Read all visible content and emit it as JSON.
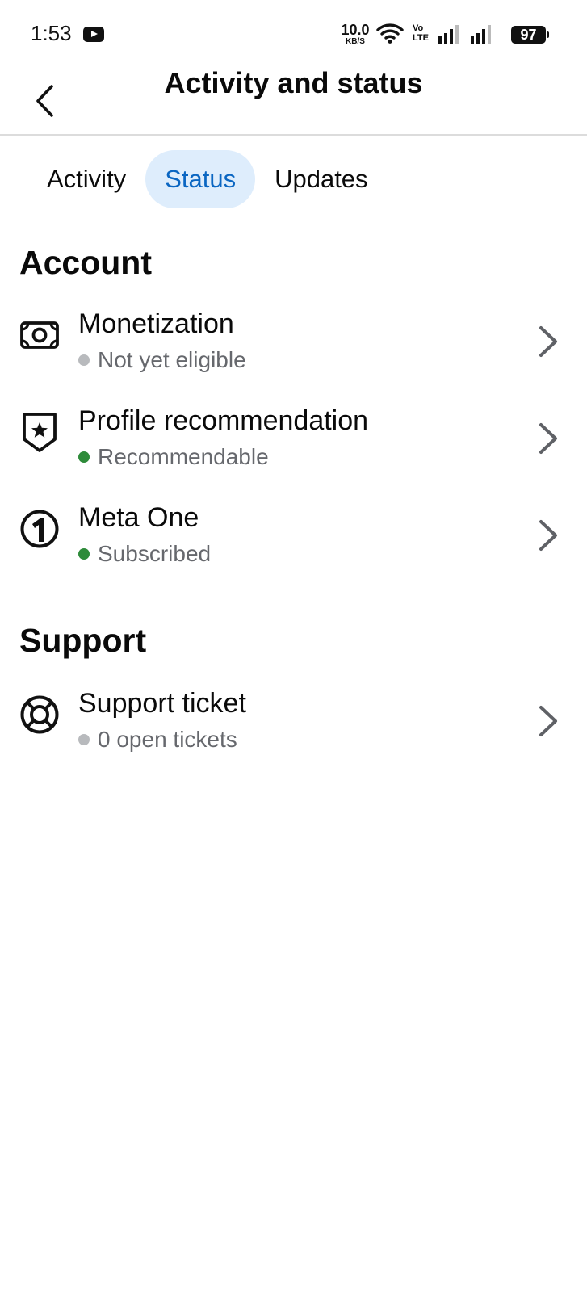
{
  "status_bar": {
    "time": "1:53",
    "notification_icon": "youtube-icon",
    "net_speed_value": "10.0",
    "net_speed_unit": "KB/S",
    "volte_top": "Vo",
    "volte_bottom": "LTE",
    "battery": "97"
  },
  "header": {
    "title": "Activity and status",
    "back_icon": "back-arrow-icon"
  },
  "tabs": [
    {
      "label": "Activity",
      "active": false
    },
    {
      "label": "Status",
      "active": true
    },
    {
      "label": "Updates",
      "active": false
    }
  ],
  "colors": {
    "accent_blue": "#0a66c2",
    "active_tab_bg": "#deedfc",
    "status_green": "#2e8b3a",
    "status_gray": "#b8babd",
    "subtitle_gray": "#66686d"
  },
  "sections": {
    "account": {
      "title": "Account",
      "items": [
        {
          "title": "Monetization",
          "status": "Not yet eligible",
          "status_color": "#b8babd",
          "icon": "money-bill-icon"
        },
        {
          "title": "Profile recommendation",
          "status": "Recommendable",
          "status_color": "#2e8b3a",
          "icon": "shield-star-icon"
        },
        {
          "title": "Meta One",
          "status": "Subscribed",
          "status_color": "#2e8b3a",
          "icon": "meta-one-icon"
        }
      ]
    },
    "support": {
      "title": "Support",
      "items": [
        {
          "title": "Support ticket",
          "status": "0 open tickets",
          "status_color": "#b8babd",
          "icon": "lifebuoy-icon"
        }
      ]
    }
  }
}
